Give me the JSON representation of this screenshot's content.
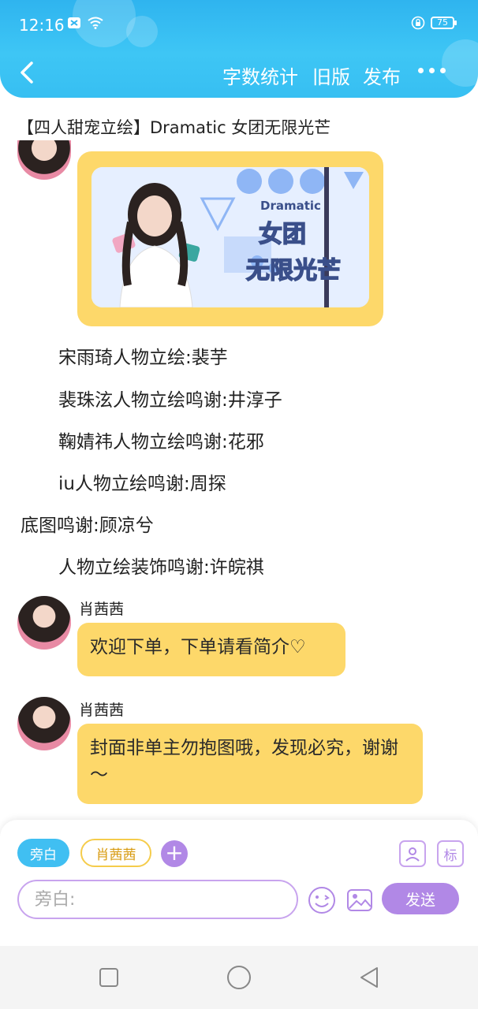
{
  "status_bar": {
    "time": "12:16",
    "battery": "75"
  },
  "nav": {
    "actions": [
      "字数统计",
      "旧版",
      "发布"
    ]
  },
  "document": {
    "title": "【四人甜宠立绘】Dramatic 女团无限光芒",
    "cover_image_text": [
      "Dramatic",
      "女团",
      "无限光芒"
    ],
    "credits": [
      "宋雨琦人物立绘:裴芋",
      "裴珠泫人物立绘鸣谢:井淳子",
      "鞠婧祎人物立绘鸣谢:花邪",
      "iu人物立绘鸣谢:周探",
      "底图鸣谢:顾凉兮",
      "人物立绘装饰鸣谢:许皖祺"
    ]
  },
  "messages": [
    {
      "sender": "肖茜茜",
      "text": "欢迎下单，下单请看简介♡"
    },
    {
      "sender": "肖茜茜",
      "text": "封面非单主勿抱图哦，发现必究，谢谢～"
    }
  ],
  "composer": {
    "chip_narration": "旁白",
    "chip_character": "肖茜茜",
    "placeholder": "旁白:",
    "send_label": "发送",
    "side_icon_1": "person-card-icon",
    "side_icon_2_text": "标"
  },
  "colors": {
    "header": "#3ec6f5",
    "bubble": "#fdd86a",
    "accent_purple": "#b188e6",
    "chip_blue": "#40bff2"
  }
}
